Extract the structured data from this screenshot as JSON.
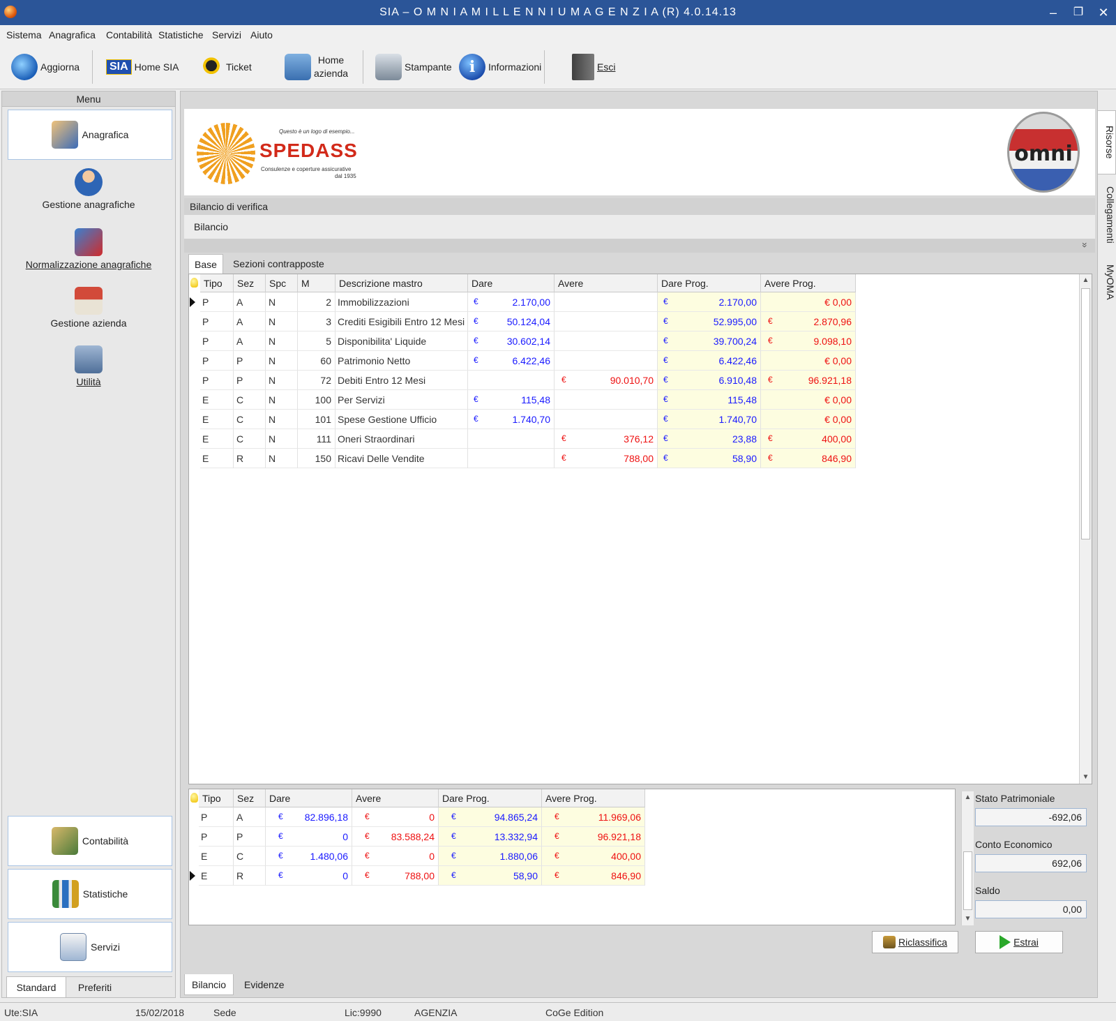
{
  "window": {
    "title": "SIA – O M N I A   M I L L E N N I U M   A G E N Z I A (R) 4.0.14.13",
    "minimize": "–",
    "restore": "❐",
    "close": "✕"
  },
  "menubar": [
    "Sistema",
    "Anagrafica",
    "Contabilità",
    "Statistiche",
    "Servizi",
    "Aiuto"
  ],
  "toolbar": {
    "aggiorna": "Aggiorna",
    "home_sia_badge": "SIA",
    "home_sia": "Home SIA",
    "ticket": "Ticket",
    "home_azienda_1": "Home",
    "home_azienda_2": "azienda",
    "stampante": "Stampante",
    "informazioni": "Informazioni",
    "esci": "Esci"
  },
  "left_menu": {
    "header": "Menu",
    "anagrafica": "Anagrafica",
    "gestione_anagrafiche": "Gestione anagrafiche",
    "normalizzazione": "Normalizzazione anagrafiche",
    "gestione_azienda": "Gestione azienda",
    "utilita": "Utilità",
    "contabilita": "Contabilità",
    "statistiche": "Statistiche",
    "servizi": "Servizi",
    "tab_standard": "Standard",
    "tab_preferiti": "Preferiti"
  },
  "logo": {
    "tagline": "Questo è un logo di esempio...",
    "brand": "SPEDASS",
    "sub1": "Consulenze e coperture assicurative",
    "sub2": "dal 1935",
    "omni_text": "omni"
  },
  "section": {
    "title": "Bilancio di verifica",
    "subtitle": "Bilancio",
    "collapse": "»"
  },
  "inner_tabs": {
    "base": "Base",
    "sezioni": "Sezioni contrapposte"
  },
  "main_grid": {
    "headers": [
      "Tipo",
      "Sez",
      "Spc",
      "M",
      "Descrizione mastro",
      "Dare",
      "Avere",
      "Dare Prog.",
      "Avere Prog."
    ],
    "currency": "€",
    "rows": [
      {
        "tipo": "P",
        "sez": "A",
        "spc": "N",
        "m": "2",
        "desc": "Immobilizzazioni",
        "dare": "2.170,00",
        "avere": "",
        "dare_prog": "2.170,00",
        "avere_prog": "€ 0,00"
      },
      {
        "tipo": "P",
        "sez": "A",
        "spc": "N",
        "m": "3",
        "desc": "Crediti Esigibili Entro 12 Mesi",
        "dare": "50.124,04",
        "avere": "",
        "dare_prog": "52.995,00",
        "avere_prog": "2.870,96"
      },
      {
        "tipo": "P",
        "sez": "A",
        "spc": "N",
        "m": "5",
        "desc": "Disponibilita' Liquide",
        "dare": "30.602,14",
        "avere": "",
        "dare_prog": "39.700,24",
        "avere_prog": "9.098,10"
      },
      {
        "tipo": "P",
        "sez": "P",
        "spc": "N",
        "m": "60",
        "desc": "Patrimonio Netto",
        "dare": "6.422,46",
        "avere": "",
        "dare_prog": "6.422,46",
        "avere_prog": "€ 0,00"
      },
      {
        "tipo": "P",
        "sez": "P",
        "spc": "N",
        "m": "72",
        "desc": "Debiti Entro 12 Mesi",
        "dare": "",
        "avere": "90.010,70",
        "dare_prog": "6.910,48",
        "avere_prog": "96.921,18"
      },
      {
        "tipo": "E",
        "sez": "C",
        "spc": "N",
        "m": "100",
        "desc": "Per Servizi",
        "dare": "115,48",
        "avere": "",
        "dare_prog": "115,48",
        "avere_prog": "€ 0,00"
      },
      {
        "tipo": "E",
        "sez": "C",
        "spc": "N",
        "m": "101",
        "desc": "Spese Gestione Ufficio",
        "dare": "1.740,70",
        "avere": "",
        "dare_prog": "1.740,70",
        "avere_prog": "€ 0,00"
      },
      {
        "tipo": "E",
        "sez": "C",
        "spc": "N",
        "m": "111",
        "desc": "Oneri Straordinari",
        "dare": "",
        "avere": "376,12",
        "dare_prog": "23,88",
        "avere_prog": "400,00"
      },
      {
        "tipo": "E",
        "sez": "R",
        "spc": "N",
        "m": "150",
        "desc": "Ricavi Delle Vendite",
        "dare": "",
        "avere": "788,00",
        "dare_prog": "58,90",
        "avere_prog": "846,90"
      }
    ]
  },
  "summary_grid": {
    "headers": [
      "Tipo",
      "Sez",
      "Dare",
      "Avere",
      "Dare Prog.",
      "Avere Prog."
    ],
    "rows": [
      {
        "tipo": "P",
        "sez": "A",
        "dare": "82.896,18",
        "avere": "0",
        "dare_prog": "94.865,24",
        "avere_prog": "11.969,06"
      },
      {
        "tipo": "P",
        "sez": "P",
        "dare": "0",
        "avere": "83.588,24",
        "dare_prog": "13.332,94",
        "avere_prog": "96.921,18"
      },
      {
        "tipo": "E",
        "sez": "C",
        "dare": "1.480,06",
        "avere": "0",
        "dare_prog": "1.880,06",
        "avere_prog": "400,00"
      },
      {
        "tipo": "E",
        "sez": "R",
        "dare": "0",
        "avere": "788,00",
        "dare_prog": "58,90",
        "avere_prog": "846,90"
      }
    ]
  },
  "totals": {
    "stato_label": "Stato Patrimoniale",
    "stato_value": "-692,06",
    "conto_label": "Conto Economico",
    "conto_value": "692,06",
    "saldo_label": "Saldo",
    "saldo_value": "0,00"
  },
  "buttons": {
    "riclassifica": "Riclassifica",
    "estrai": "Estrai"
  },
  "bottom_tabs": {
    "bilancio": "Bilancio",
    "evidenze": "Evidenze"
  },
  "side_tabs": [
    "Risorse",
    "Collegamenti",
    "MyOMA"
  ],
  "status": {
    "user": "Ute:SIA",
    "date": "15/02/2018",
    "sede": "Sede",
    "lic": "Lic:9990",
    "agenzia": "AGENZIA",
    "edition": "CoGe Edition"
  },
  "colors": {
    "titlebar": "#2b5598",
    "positive": "#1a1aff",
    "negative": "#ee1111",
    "prog_highlight": "#fdfde0"
  }
}
